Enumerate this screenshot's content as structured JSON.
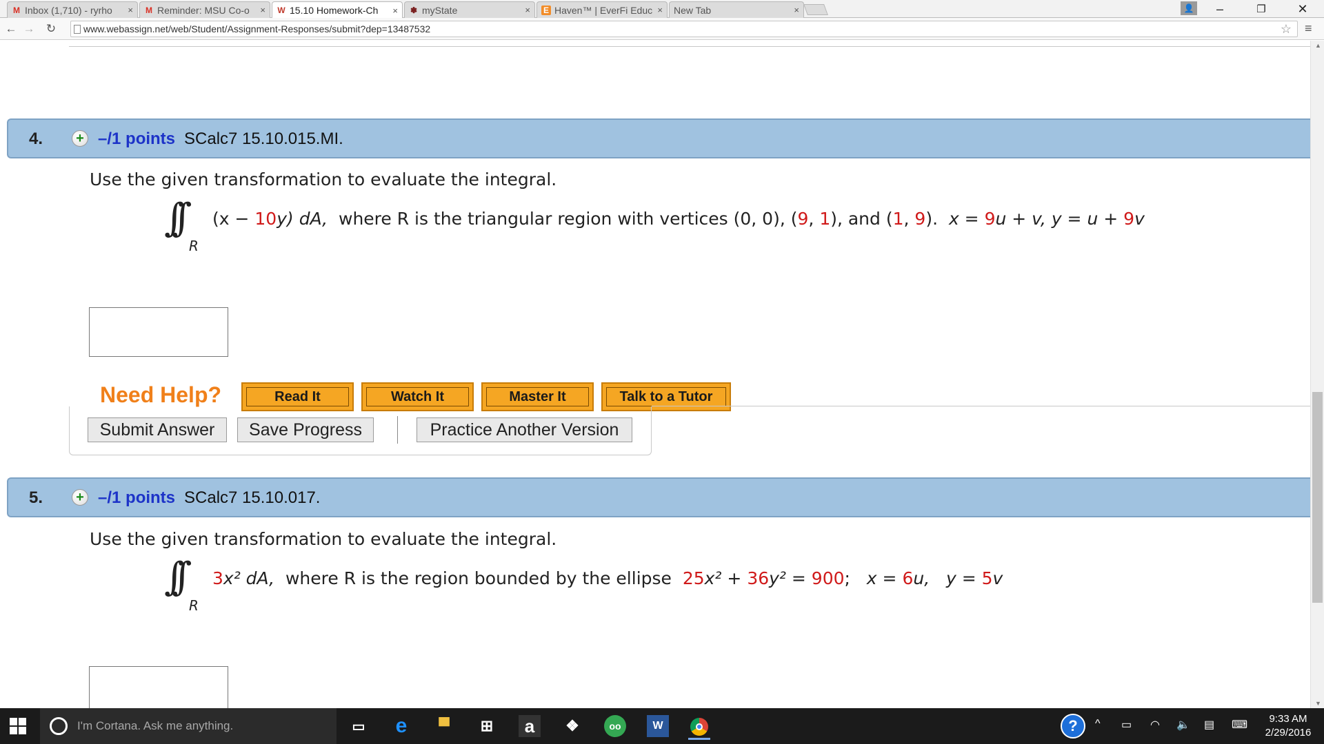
{
  "browser": {
    "tabs": [
      {
        "label": "Inbox (1,710) - ryrho",
        "favicon": "M",
        "color": "#d93025"
      },
      {
        "label": "Reminder: MSU Co-o",
        "favicon": "M",
        "color": "#d93025"
      },
      {
        "label": "15.10 Homework-Ch",
        "favicon": "W",
        "color": "#c0392b"
      },
      {
        "label": "myState",
        "favicon": "✽",
        "color": "#7a1f1f"
      },
      {
        "label": "Haven™ | EverFi Educ",
        "favicon": "E",
        "color": "#f28c28"
      },
      {
        "label": "New Tab",
        "favicon": "",
        "color": "#555555"
      }
    ],
    "url": "www.webassign.net/web/Student/Assignment-Responses/submit?dep=13487532"
  },
  "questions": [
    {
      "number": "4.",
      "points": "–/1 points",
      "code": "SCalc7 15.10.015.MI.",
      "instruction": "Use the given transformation to evaluate the integral.",
      "integral_sub": "R",
      "integrand_a": "(x − ",
      "integrand_red": "10",
      "integrand_b": "y) dA,",
      "desc": "where R is the triangular region with vertices (0, 0), (",
      "v1a": "9",
      "v1sep": ", ",
      "v1b": "1",
      "v2pre": "), and (",
      "v2a": "1",
      "v2sep": ", ",
      "v2b": "9",
      "v2post": ").",
      "t1": "x = ",
      "t1red": "9",
      "t1b": "u + v, y = u + ",
      "t1red2": "9",
      "t1c": "v"
    },
    {
      "number": "5.",
      "points": "–/1 points",
      "code": "SCalc7 15.10.017.",
      "instruction": "Use the given transformation to evaluate the integral.",
      "integral_sub": "R",
      "coef": "3",
      "integrand": "x² dA,",
      "desc": "where R is the region bounded by the ellipse",
      "e_a": "25",
      "e_b": "x² + ",
      "e_c": "36",
      "e_d": "y² = ",
      "e_e": "900",
      "e_f": ";",
      "t_a": "x = ",
      "t_b": "6",
      "t_c": "u,",
      "t_d": "y = ",
      "t_e": "5",
      "t_f": "v"
    }
  ],
  "help": {
    "label": "Need Help?",
    "read": "Read It",
    "watch": "Watch It",
    "master": "Master It",
    "tutor": "Talk to a Tutor"
  },
  "actions": {
    "submit": "Submit Answer",
    "save": "Save Progress",
    "practice": "Practice Another Version"
  },
  "taskbar": {
    "cortana": "I'm Cortana. Ask me anything.",
    "time": "9:33 AM",
    "date": "2/29/2016"
  }
}
